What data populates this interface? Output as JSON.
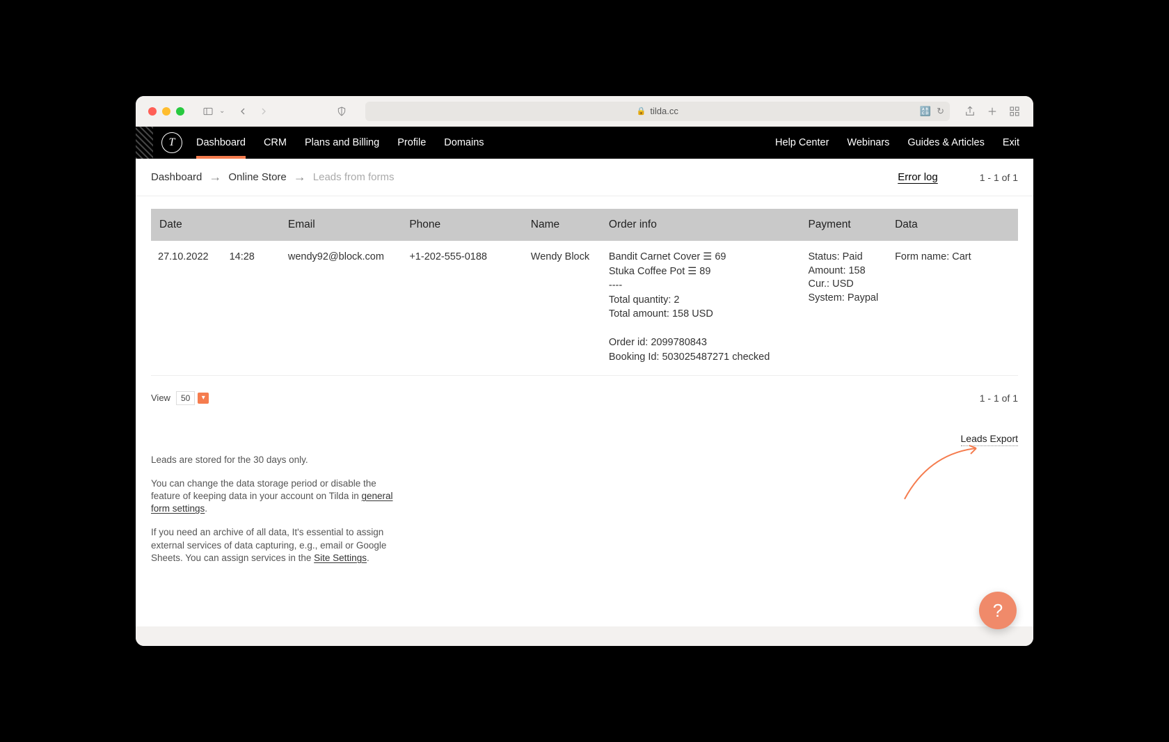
{
  "browser": {
    "url": "tilda.cc"
  },
  "nav": {
    "left": [
      "Dashboard",
      "CRM",
      "Plans and Billing",
      "Profile",
      "Domains"
    ],
    "right": [
      "Help Center",
      "Webinars",
      "Guides & Articles",
      "Exit"
    ],
    "active_index": 0
  },
  "breadcrumb": {
    "items": [
      "Dashboard",
      "Online Store",
      "Leads from forms"
    ],
    "error_log": "Error log",
    "pagination": "1 - 1 of 1"
  },
  "table": {
    "headers": [
      "Date",
      "Email",
      "Phone",
      "Name",
      "Order info",
      "Payment",
      "Data"
    ],
    "rows": [
      {
        "date": "27.10.2022",
        "time": "14:28",
        "email": "wendy92@block.com",
        "phone": "+1-202-555-0188",
        "name": "Wendy Block",
        "order_info": [
          "Bandit Carnet Cover ☰ 69",
          "Stuka Coffee Pot ☰ 89",
          "----",
          "Total quantity: 2",
          "Total amount: 158 USD",
          "",
          "Order id: 2099780843",
          "Booking Id: 503025487271 checked"
        ],
        "payment": [
          "Status: Paid",
          "Amount: 158",
          "Cur.: USD",
          "System: Paypal"
        ],
        "data": "Form name: Cart"
      }
    ]
  },
  "view": {
    "label": "View",
    "value": "50",
    "pagination": "1 - 1 of 1"
  },
  "info": {
    "p1": "Leads are stored for the 30 days only.",
    "p2_a": "You can change the data storage period or disable the feature of keeping data in your account on Tilda in ",
    "p2_link": "general form settings",
    "p3_a": "If you need an archive of all data, It's essential to assign external services of data capturing, e.g., email or Google Sheets. You can assign services in the ",
    "p3_link": "Site Settings"
  },
  "leads_export": "Leads Export",
  "help_fab": "?"
}
